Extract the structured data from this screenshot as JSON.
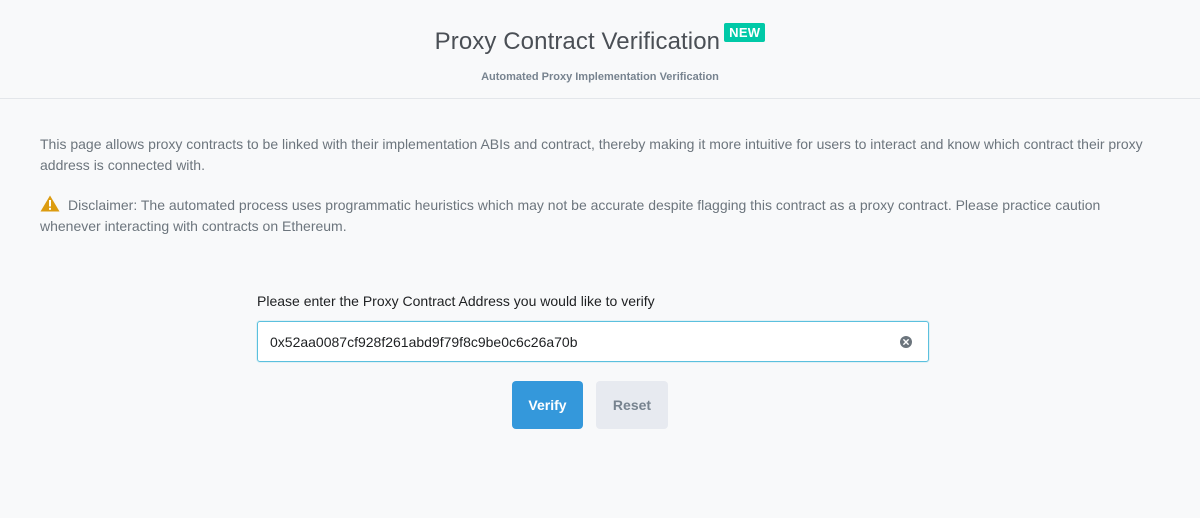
{
  "header": {
    "title": "Proxy Contract Verification",
    "badge": "NEW",
    "subtitle": "Automated Proxy Implementation Verification"
  },
  "content": {
    "description": "This page allows proxy contracts to be linked with their implementation ABIs and contract, thereby making it more intuitive for users to interact and know which contract their proxy address is connected with.",
    "disclaimer": "Disclaimer: The automated process uses programmatic heuristics which may not be accurate despite flagging this contract as a proxy contract. Please practice caution whenever interacting with contracts on Ethereum."
  },
  "form": {
    "label": "Please enter the Proxy Contract Address you would like to verify",
    "address_value": "0x52aa0087cf928f261abd9f79f8c9be0c6c26a70b",
    "verify_label": "Verify",
    "reset_label": "Reset"
  },
  "icons": {
    "warning": "warning-triangle-icon",
    "clear": "clear-circle-x-icon"
  },
  "colors": {
    "badge": "#00c9a7",
    "primary": "#3498db",
    "warning": "#dc9c10",
    "input_border": "#5bc0de"
  }
}
